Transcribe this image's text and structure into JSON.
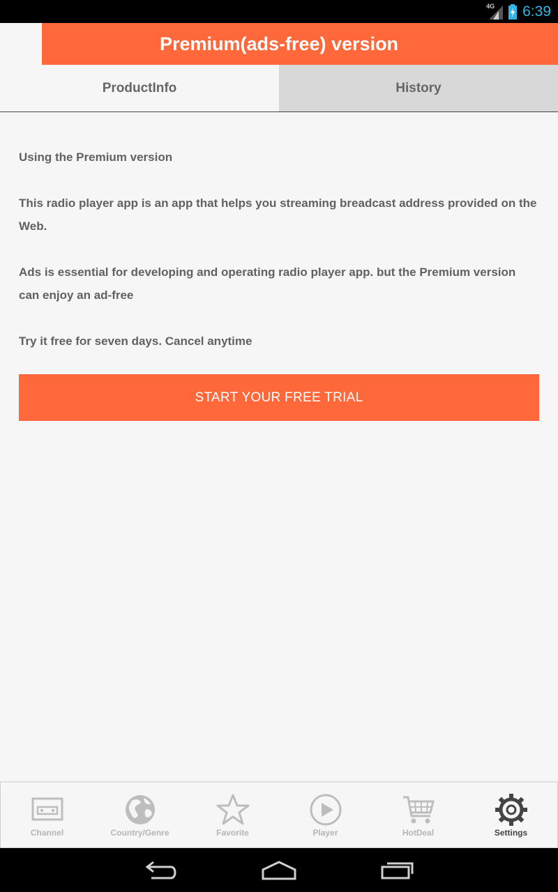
{
  "status": {
    "network_type": "4G",
    "time": "6:39"
  },
  "header": {
    "title": "Premium(ads-free) version"
  },
  "tabs": [
    {
      "label": "ProductInfo",
      "active": true
    },
    {
      "label": "History",
      "active": false
    }
  ],
  "content": {
    "paragraphs": [
      "Using the Premium version",
      "This radio player app is an app that helps you streaming breadcast address provided on the Web.",
      "Ads is essential for developing and operating radio player app. but the Premium version can enjoy an ad-free",
      "Try it free for seven days. Cancel anytime"
    ],
    "trial_button": "START YOUR FREE TRIAL"
  },
  "bottom_nav": [
    {
      "label": "Channel",
      "icon": "radio-icon"
    },
    {
      "label": "Country/Genre",
      "icon": "globe-icon"
    },
    {
      "label": "Favorite",
      "icon": "star-icon"
    },
    {
      "label": "Player",
      "icon": "play-icon"
    },
    {
      "label": "HotDeal",
      "icon": "cart-icon"
    },
    {
      "label": "Settings",
      "icon": "gear-icon",
      "active": true
    }
  ],
  "colors": {
    "accent": "#ff683a",
    "background": "#f6f6f6",
    "clock": "#33b5e5"
  }
}
